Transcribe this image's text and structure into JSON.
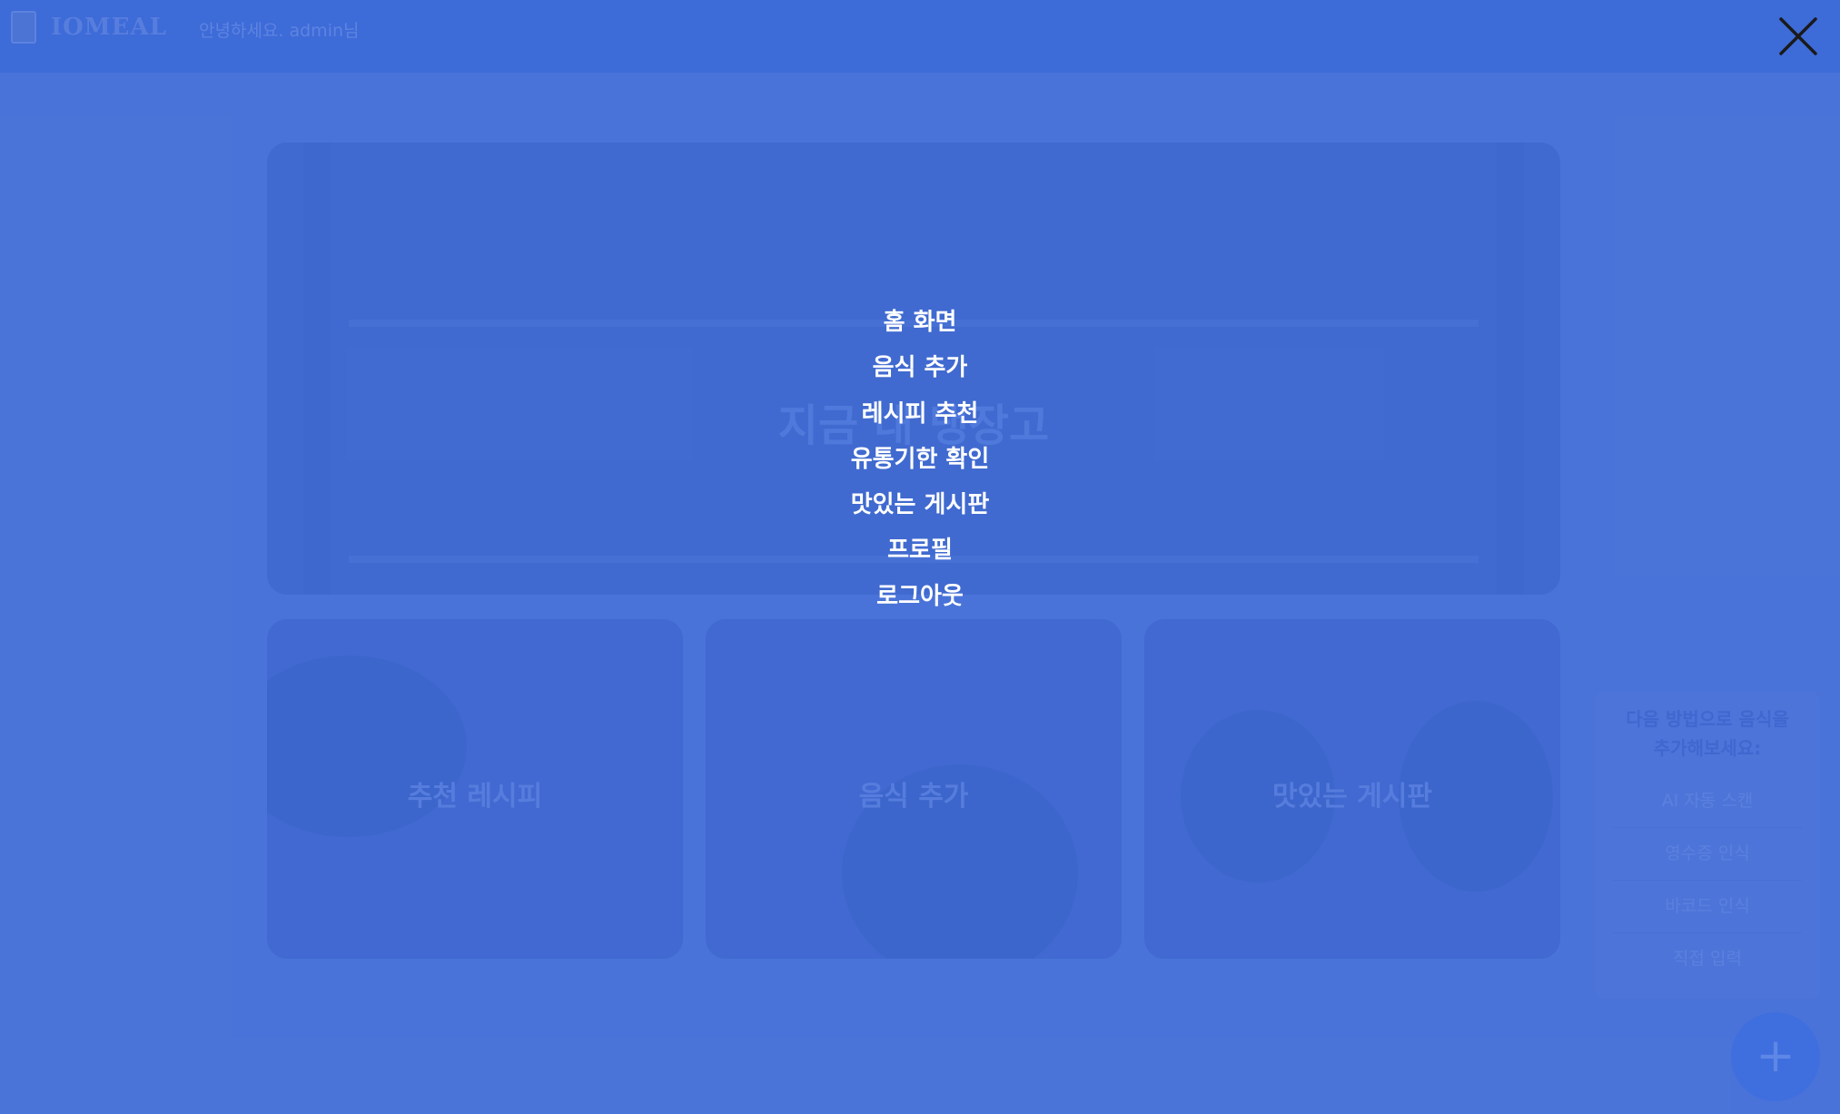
{
  "header": {
    "logo_text": "IOMEAL",
    "greeting": "안녕하세요. admin님"
  },
  "hero": {
    "title": "지금 내 냉장고"
  },
  "cards": [
    {
      "label": "추천 레시피"
    },
    {
      "label": "음식 추가"
    },
    {
      "label": "맛있는 게시판"
    }
  ],
  "side_panel": {
    "title": "다음 방법으로 음식을 추가해보세요:",
    "options": [
      "AI 자동 스캔",
      "영수증 인식",
      "바코드 인식",
      "직접 입력"
    ]
  },
  "fab": {
    "icon": "plus-icon",
    "symbol": "+"
  },
  "overlay": {
    "close_icon": "close-icon",
    "menu": [
      "홈 화면",
      "음식 추가",
      "레시피 추천",
      "유통기한 확인",
      "맛있는 게시판",
      "프로필",
      "로그아웃"
    ]
  },
  "colors": {
    "background": "#4f77d6",
    "header": "#3d6ad6",
    "menu_text": "#ffffff",
    "close_icon": "#1a1a1a"
  }
}
